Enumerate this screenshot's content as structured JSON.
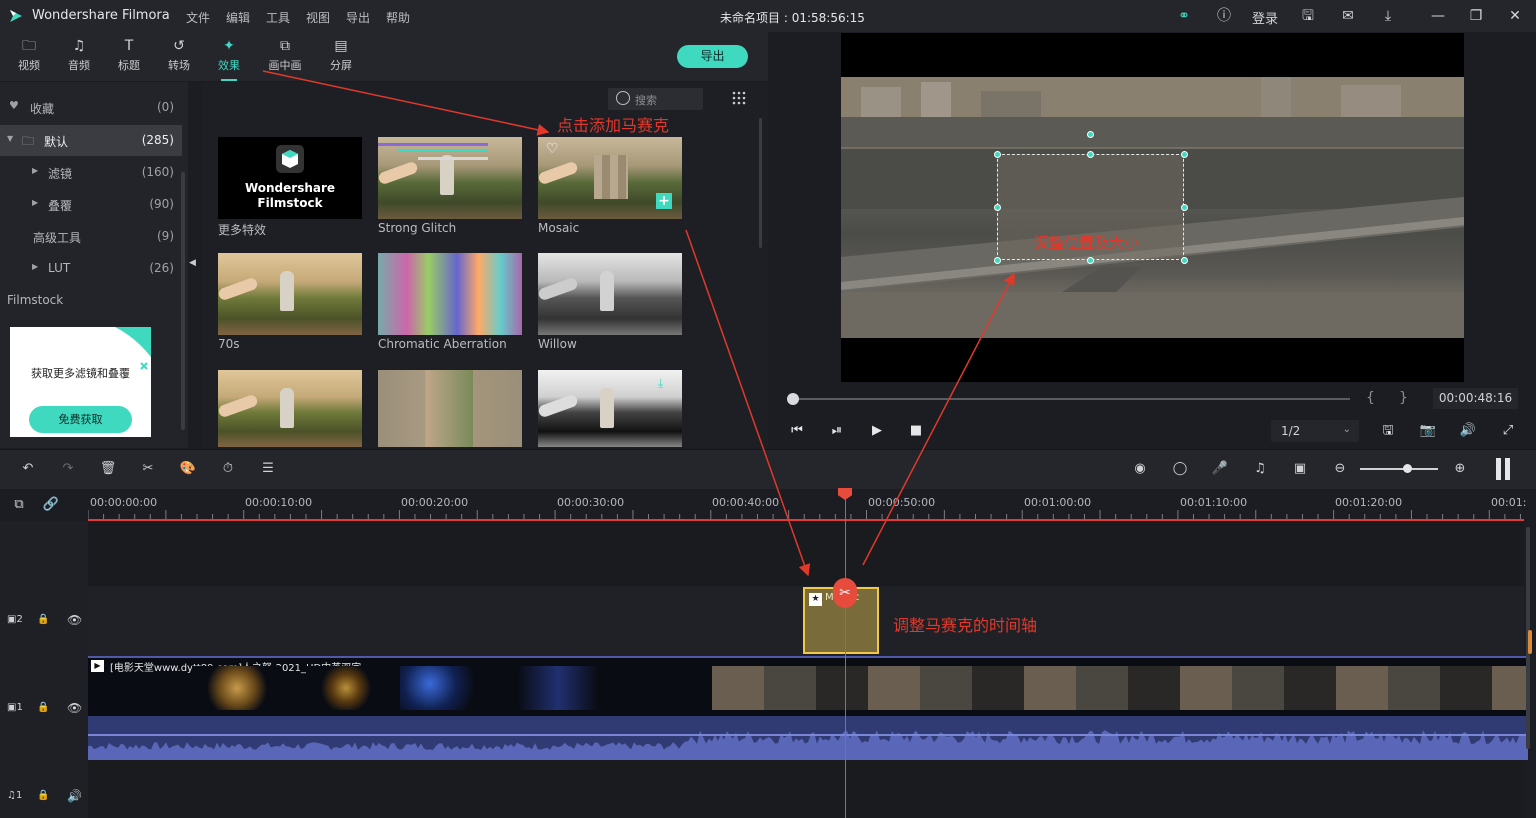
{
  "app": {
    "name": "Wondershare Filmora",
    "project": "未命名项目 : 01:58:56:15",
    "menu": [
      "文件",
      "编辑",
      "工具",
      "视图",
      "导出",
      "帮助"
    ],
    "login": "登录"
  },
  "media_tabs": [
    {
      "label": "视频",
      "icon": "folder-icon"
    },
    {
      "label": "音频",
      "icon": "music-note-icon"
    },
    {
      "label": "标题",
      "icon": "text-t-icon"
    },
    {
      "label": "转场",
      "icon": "transition-icon"
    },
    {
      "label": "效果",
      "icon": "effects-wand-icon",
      "active": true
    },
    {
      "label": "画中画",
      "icon": "pip-icon"
    },
    {
      "label": "分屏",
      "icon": "split-screen-icon"
    }
  ],
  "export_label": "导出",
  "sidebar": {
    "items": [
      {
        "label": "收藏",
        "count": "(0)",
        "icon": "heart-icon"
      },
      {
        "label": "默认",
        "count": "(285)",
        "icon": "folder-icon",
        "active": true
      },
      {
        "label": "滤镜",
        "count": "(160)"
      },
      {
        "label": "叠覆",
        "count": "(90)"
      },
      {
        "label": "高级工具",
        "count": "(9)"
      },
      {
        "label": "LUT",
        "count": "(26)"
      }
    ],
    "filmstock": "Filmstock",
    "promo_text": "获取更多滤镜和叠覆",
    "promo_button": "免费获取"
  },
  "effects": {
    "search_placeholder": "搜索",
    "filmstock_logo_line1": "Wondershare",
    "filmstock_logo_line2": "Filmstock",
    "items": [
      {
        "label": "更多特效"
      },
      {
        "label": "Strong Glitch"
      },
      {
        "label": "Mosaic"
      },
      {
        "label": "70s"
      },
      {
        "label": "Chromatic Aberration"
      },
      {
        "label": "Willow"
      }
    ]
  },
  "preview": {
    "timecode": "00:00:48:16",
    "zoom": "1/2",
    "progress": 0.01,
    "brace_left": "{",
    "brace_right": "}"
  },
  "timeline": {
    "ruler": [
      "00:00:00:00",
      "00:00:10:00",
      "00:00:20:00",
      "00:00:30:00",
      "00:00:40:00",
      "00:00:50:00",
      "00:01:00:00",
      "00:01:10:00",
      "00:01:20:00",
      "00:01:"
    ],
    "video_clip_title": "[电影天堂www.dytt89.com]人之怒-2021_HD中英双字",
    "mosaic_clip_label": "Mosaic",
    "tracks": [
      {
        "id": "2",
        "icon": "video-track-icon"
      },
      {
        "id": "1",
        "icon": "video-track-icon"
      },
      {
        "id": "1",
        "icon": "audio-track-icon"
      }
    ]
  },
  "annotations": {
    "add_mosaic": "点击添加马赛克",
    "adjust_box": "调整位置及大小",
    "adjust_timeline": "调整马赛克的时间轴"
  },
  "colors": {
    "accent": "#3fd9bf",
    "annotation": "#e0392b",
    "playhead": "#e64b3c",
    "mosaic_clip_border": "#f0c84a"
  }
}
